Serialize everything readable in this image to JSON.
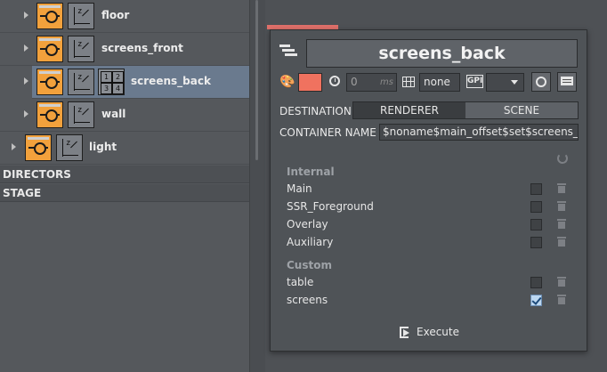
{
  "tree": {
    "items": [
      {
        "label": "floor"
      },
      {
        "label": "screens_front"
      },
      {
        "label": "screens_back"
      },
      {
        "label": "wall"
      },
      {
        "label": "light"
      }
    ],
    "grid_icon_cells": [
      "1",
      "2",
      "3",
      "4"
    ]
  },
  "sections": {
    "directors": "DIRECTORS",
    "stage": "STAGE"
  },
  "panel": {
    "title": "screens_back",
    "color": "#f0725f",
    "delay_value": "0",
    "delay_unit": "ms",
    "grid_value": "none",
    "gpi_label": "GPI",
    "select_value": "",
    "destination_label": "DESTINATION:",
    "destination_options": [
      "RENDERER",
      "SCENE"
    ],
    "destination_selected": "RENDERER",
    "container_name_label": "CONTAINER NAME",
    "container_name_value": "$noname$main_offset$set$screens_back",
    "groups": [
      {
        "title": "Internal",
        "items": [
          {
            "label": "Main",
            "checked": false
          },
          {
            "label": "SSR_Foreground",
            "checked": false
          },
          {
            "label": "Overlay",
            "checked": false
          },
          {
            "label": "Auxiliary",
            "checked": false
          }
        ]
      },
      {
        "title": "Custom",
        "items": [
          {
            "label": "table",
            "checked": false
          },
          {
            "label": "screens",
            "checked": true
          }
        ]
      }
    ],
    "execute_label": "Execute"
  }
}
